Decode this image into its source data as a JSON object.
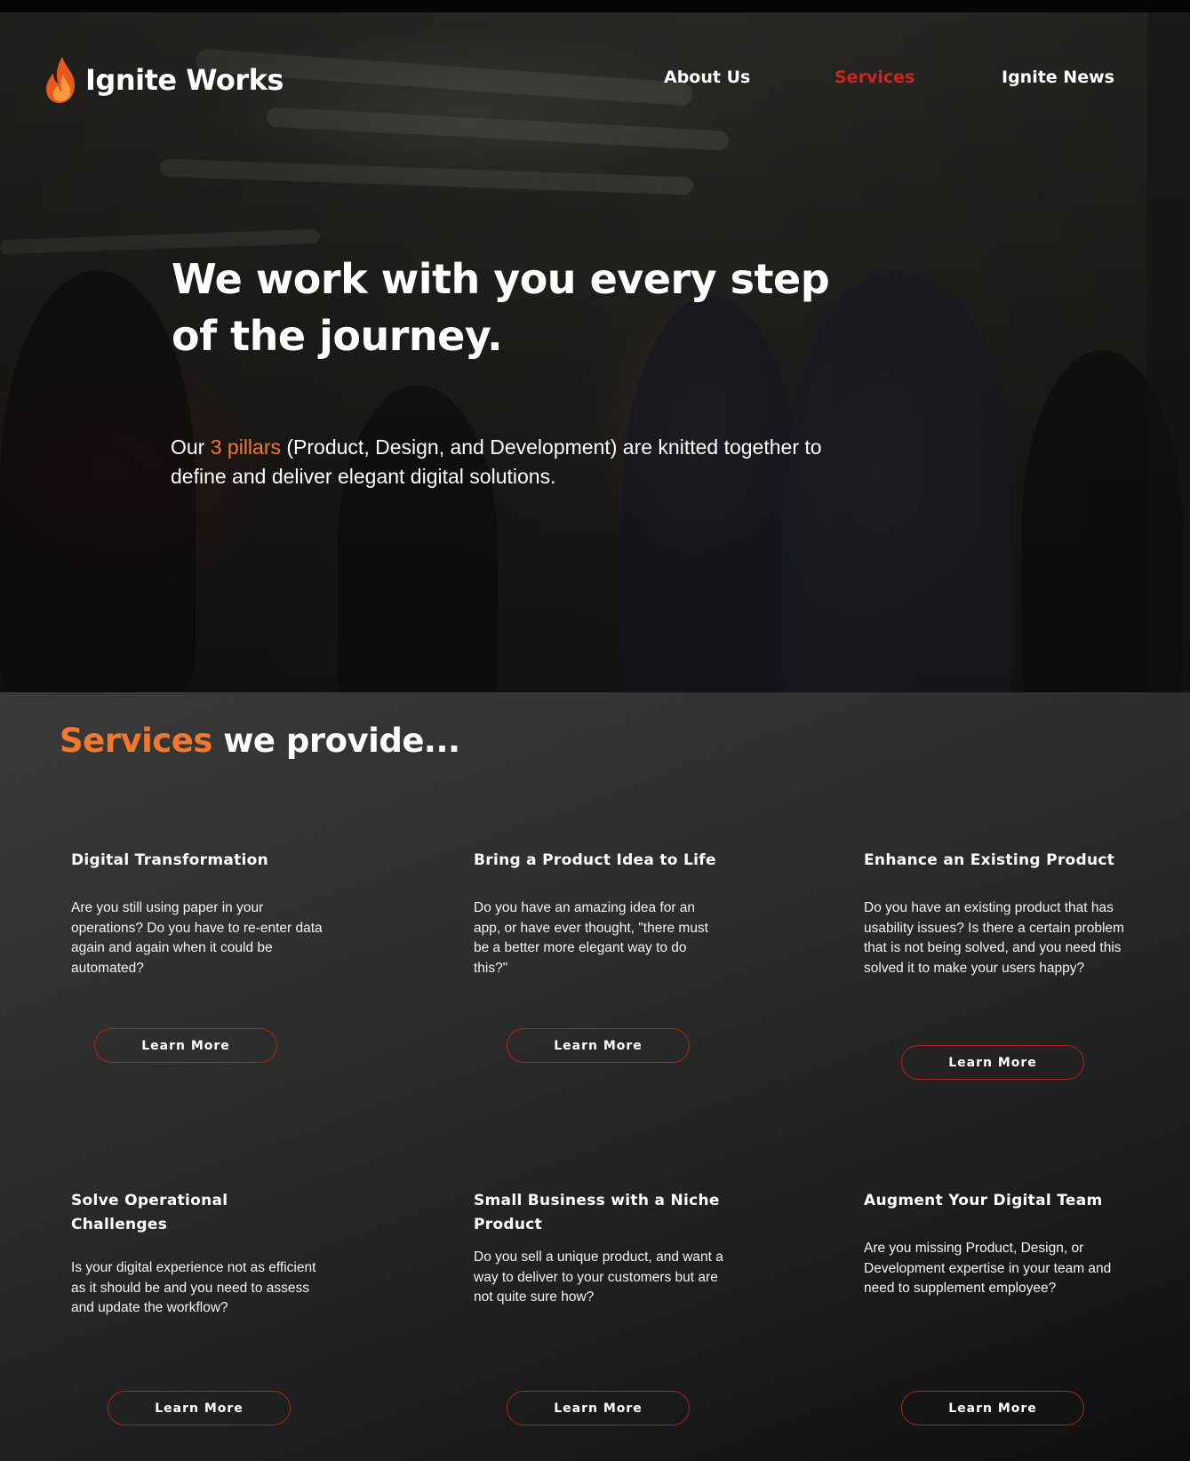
{
  "brand": {
    "name": "Ignite Works",
    "logo_icon": "flame-icon",
    "accent_color": "#f2782e",
    "active_color": "#c8281e"
  },
  "nav": {
    "items": [
      {
        "label": "About Us",
        "active": false
      },
      {
        "label": "Services",
        "active": true
      },
      {
        "label": "Ignite News",
        "active": false
      }
    ]
  },
  "hero": {
    "title": "We work with you every step of the journey.",
    "subtitle_before": "Our ",
    "subtitle_highlight": "3 pillars",
    "subtitle_after": " (Product, Design, and Development) are knitted together to define and deliver elegant digital solutions."
  },
  "services": {
    "heading_highlight": "Services",
    "heading_rest": " we provide...",
    "cards": [
      {
        "title": "Digital Transformation",
        "description": "Are you still using paper in your operations? Do you have to re-enter data again and again when it could be automated?",
        "button": "Learn More"
      },
      {
        "title": "Bring a Product Idea to Life",
        "description": "Do you have an amazing idea for an app, or have ever thought, \"there must be a better more elegant way to do this?\"",
        "button": "Learn More"
      },
      {
        "title": "Enhance an Existing Product",
        "description": "Do you have an existing product that has usability issues? Is there a certain problem that is not being solved, and you need this solved it to make your users happy?",
        "button": "Learn More"
      },
      {
        "title": "Solve Operational Challenges",
        "description": "Is your digital experience not as efficient as it should be and you need to assess and update the workflow?",
        "button": "Learn More"
      },
      {
        "title": "Small Business with a Niche Product",
        "description": "Do you sell a unique product, and want a way to deliver to your customers but are not quite sure how?",
        "button": "Learn More"
      },
      {
        "title": "Augment Your Digital Team",
        "description": "Are you missing Product, Design, or Development expertise in your team and need to supplement employee?",
        "button": "Learn More"
      }
    ]
  }
}
